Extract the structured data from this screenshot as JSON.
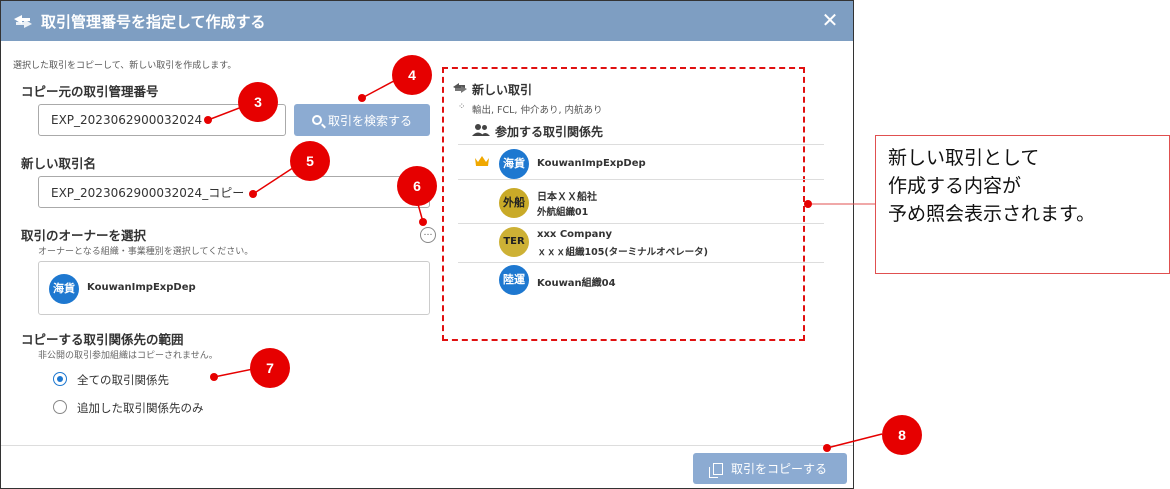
{
  "dialog": {
    "title": "取引管理番号を指定して作成する",
    "close_glyph": "✕",
    "description": "選択した取引をコピーして、新しい取引を作成します。"
  },
  "source": {
    "label": "コピー元の取引管理番号",
    "value": "EXP_2023062900032024",
    "search_label": "取引を検索する"
  },
  "new_name": {
    "label": "新しい取引名",
    "value": "EXP_2023062900032024_コピー"
  },
  "owner": {
    "label": "取引のオーナーを選択",
    "hint": "オーナーとなる組織・事業種別を選択してください。",
    "more_glyph": "…",
    "badge": "海貨",
    "name": "KouwanImpExpDep"
  },
  "scope": {
    "label": "コピーする取引関係先の範囲",
    "hint": "非公開の取引参加組織はコピーされません。",
    "options": [
      {
        "label": "全ての取引関係先",
        "checked": true
      },
      {
        "label": "追加した取引関係先のみ",
        "checked": false
      }
    ]
  },
  "footer": {
    "copy_label": "取引をコピーする"
  },
  "preview": {
    "title": "新しい取引",
    "tags": "輸出, FCL, 仲介あり, 内航あり",
    "participants_label": "参加する取引関係先",
    "participants": [
      {
        "badge": "海貨",
        "name": "KouwanImpExpDep",
        "sub": "",
        "owner": true
      },
      {
        "badge": "外船",
        "name": "日本ＸＸ船社",
        "sub": "外航組織01",
        "owner": false
      },
      {
        "badge": "TER",
        "name": "xxx Company",
        "sub": "ｘｘｘ組織105(ターミナルオペレータ)",
        "owner": false
      },
      {
        "badge": "陸運",
        "name": "Kouwan組織04",
        "sub": "",
        "owner": false
      }
    ]
  },
  "callouts": [
    "3",
    "4",
    "5",
    "6",
    "7",
    "8"
  ],
  "note": {
    "lines": [
      "新しい取引として",
      "作成する内容が",
      "予め照会表示されます。"
    ]
  },
  "colors": {
    "titlebar": "#7e9ec2",
    "button": "#8cabd2",
    "accent_blue": "#1e78d0",
    "callout_red": "#e60000",
    "badge_gold": "#c9aa28"
  }
}
